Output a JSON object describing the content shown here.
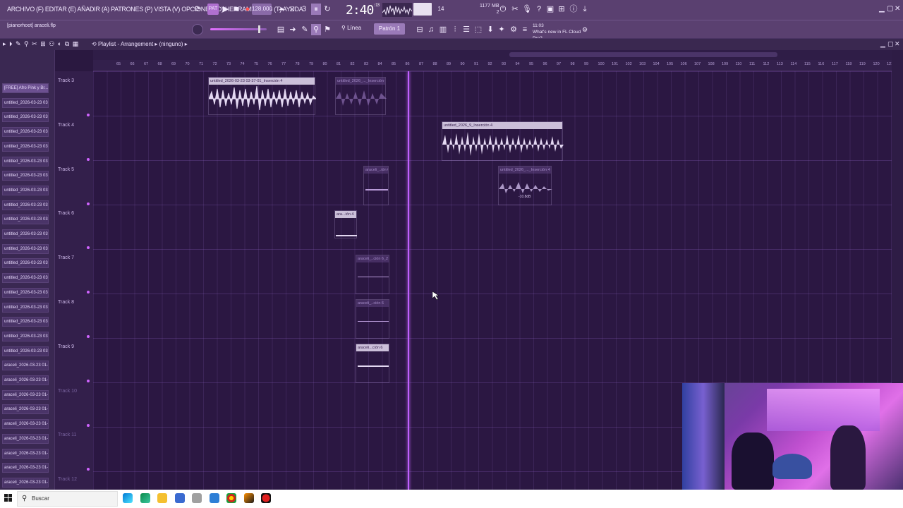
{
  "menubar": {
    "menus": "ARCHIVO (F)  EDITAR (E)  AÑADIR (A)  PATRONES (P)  VISTA (V)  OPCIONES (O)  HERRAMIENTAS (T)  AYUDA",
    "tempo": "128.000",
    "time": "2:40",
    "time_small": ":13",
    "time_unit": "M:S:CS",
    "memory_cpu": "14",
    "memory": "1177 MB",
    "memory2": "2"
  },
  "subbar": {
    "hint": "[pianorhoot] araceli.flp",
    "snap_label": "Línea",
    "pattern_label": "Patrón 1",
    "news_time": "11:03",
    "news_text": "What's new in FL Cloud Pro?"
  },
  "playlist": {
    "title": "Playlist - Arrangement",
    "title_suffix": "(ninguno)"
  },
  "patterns": [
    "[FREE] Afro Pink y Br...",
    "untitled_2026-03-23 03:...",
    "untitled_2026-03-23 03:...",
    "untitled_2026-03-23 03:...",
    "untitled_2026-03-23 03:...",
    "untitled_2026-03-23 03:...",
    "untitled_2026-03-23 03:...",
    "untitled_2026-03-23 03:...",
    "untitled_2026-03-23 03:...",
    "untitled_2026-03-23 03:...",
    "untitled_2026-03-23 03:...",
    "untitled_2026-03-23 03:...",
    "untitled_2026-03-23 03:...",
    "untitled_2026-03-23 03:...",
    "untitled_2026-03-23 03:...",
    "untitled_2026-03-23 03:...",
    "untitled_2026-03-23 03:...",
    "untitled_2026-03-23 03:...",
    "untitled_2026-03-23 03:...",
    "araceli_2026-03-23 01-4...",
    "araceli_2026-03-23 01-4...",
    "araceli_2026-03-23 01-4...",
    "araceli_2026-03-23 01-4...",
    "araceli_2026-03-23 01-4...",
    "araceli_2026-03-23 01-4...",
    "araceli_2026-03-23 01-4...",
    "araceli_2026-03-23 01-4...",
    "araceli_2026-03-23 01-4...",
    "araceli_2026-03-23 01-5..."
  ],
  "tracks": [
    "Track 3",
    "Track 4",
    "Track 5",
    "Track 6",
    "Track 7",
    "Track 8",
    "Track 9",
    "Track 10",
    "Track 11",
    "Track 12"
  ],
  "ruler_ticks": [
    "65",
    "66",
    "67",
    "68",
    "69",
    "70",
    "71",
    "72",
    "73",
    "74",
    "75",
    "76",
    "77",
    "78",
    "79",
    "80",
    "81",
    "82",
    "83",
    "84",
    "85",
    "86",
    "87",
    "88",
    "89",
    "90",
    "91",
    "92",
    "93",
    "94",
    "95",
    "96",
    "97",
    "98",
    "99",
    "100",
    "101",
    "102",
    "103",
    "104",
    "105",
    "106",
    "107",
    "108",
    "109",
    "110",
    "111",
    "112",
    "113",
    "114",
    "115",
    "116",
    "117",
    "118",
    "119",
    "120",
    "121"
  ],
  "clips": {
    "c1": "untitled_2026-03-23 03-37-01_Inserción 4",
    "c2": "untitled_2026_..._Inserción 4",
    "c3": "untitled_...serción 4",
    "c3b": "untitled_2026_9_Inserción 4",
    "c4": "araceli_..ión 6",
    "c5": "untitled_2026_..._Inserción 4",
    "c5_value": "-10.8dB",
    "c6": "ara...ión 4",
    "c7": "araceli_..ción 6_2",
    "c8": "araceli_..ción 6",
    "c9": "araceli...ción 6"
  },
  "taskbar": {
    "search_placeholder": "Buscar"
  },
  "colors": {
    "accent": "#c060ff",
    "toolbar": "#5a4070",
    "grid": "#2b1742"
  }
}
